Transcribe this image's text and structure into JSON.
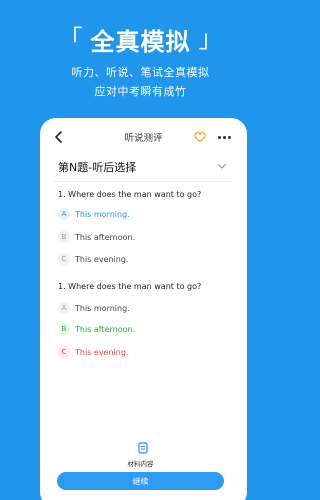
{
  "hero": {
    "title": "全真模拟",
    "left_bracket": "「",
    "right_bracket": "」",
    "subtitle1": "听力、听说、笔试全真模拟",
    "subtitle2": "应对中考瞬有成竹"
  },
  "nav": {
    "title": "听说测评",
    "back_icon": "back-arrow-icon",
    "favorite_icon": "heart-icon",
    "more_icon": "more-icon"
  },
  "section": {
    "title": "第N题-听后选择"
  },
  "questions": [
    {
      "text": "1. Where does the man want to go?",
      "options": [
        {
          "letter": "A",
          "text": "This morning.",
          "state": "selected"
        },
        {
          "letter": "B",
          "text": "This afternoon.",
          "state": "normal"
        },
        {
          "letter": "C",
          "text": "This evening.",
          "state": "normal"
        }
      ]
    },
    {
      "text": "1. Where does the man want to go?",
      "options": [
        {
          "letter": "A",
          "text": "This morning.",
          "state": "normal"
        },
        {
          "letter": "B",
          "text": "This afternoon.",
          "state": "correct"
        },
        {
          "letter": "C",
          "text": "This evening.",
          "state": "wrong"
        }
      ]
    }
  ],
  "bottom": {
    "material_label": "材料内容",
    "continue_label": "继续"
  },
  "colors": {
    "background": "#1f95ec",
    "accent": "#1d95ea",
    "correct": "#24b23a",
    "wrong": "#f24646",
    "heart": "#f39c2b"
  }
}
